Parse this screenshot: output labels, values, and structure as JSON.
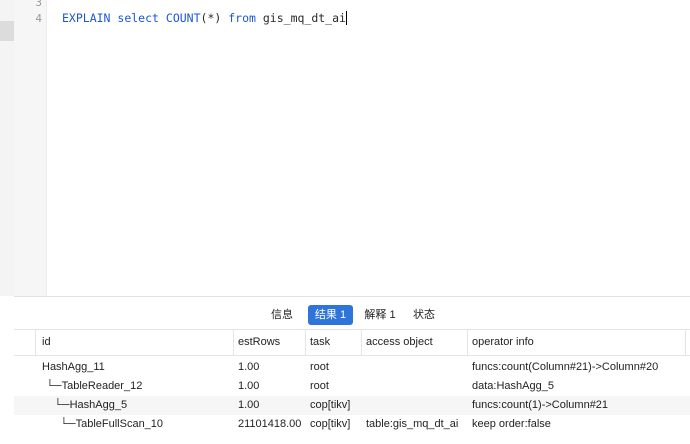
{
  "editor": {
    "line_numbers": [
      "3",
      "4"
    ],
    "code": {
      "kw1": "EXPLAIN",
      "kw2": "select",
      "fn": "COUNT",
      "args": "(*)",
      "kw3": "from",
      "table": "gis_mq_dt_ai"
    }
  },
  "tabs": [
    {
      "label": "信息",
      "active": false
    },
    {
      "label": "结果 1",
      "active": true
    },
    {
      "label": "解释 1",
      "active": false
    },
    {
      "label": "状态",
      "active": false
    }
  ],
  "table": {
    "columns": [
      "id",
      "estRows",
      "task",
      "access object",
      "operator info"
    ],
    "rows": [
      [
        "HashAgg_11",
        "1.00",
        "root",
        "",
        "funcs:count(Column#21)->Column#20"
      ],
      [
        "└─TableReader_12",
        "1.00",
        "root",
        "",
        "data:HashAgg_5"
      ],
      [
        "└─HashAgg_5",
        "1.00",
        "cop[tikv]",
        "",
        "funcs:count(1)->Column#21"
      ],
      [
        "└─TableFullScan_10",
        "21101418.00",
        "cop[tikv]",
        "table:gis_mq_dt_ai",
        "keep order:false"
      ]
    ]
  }
}
